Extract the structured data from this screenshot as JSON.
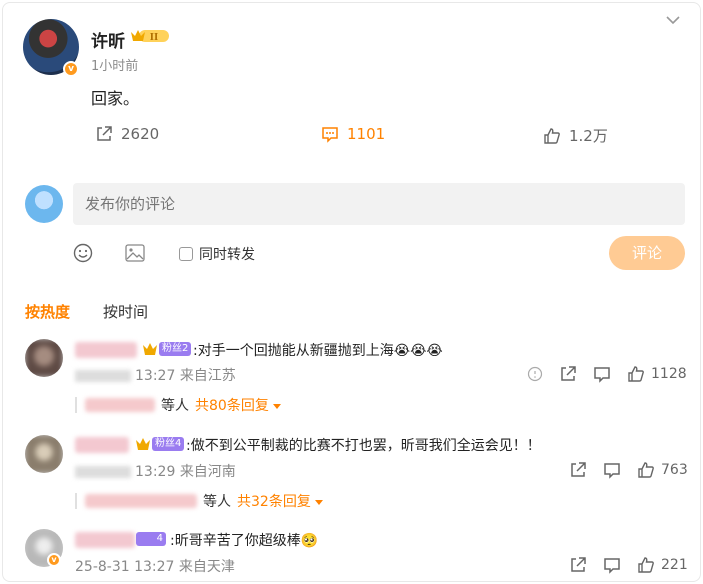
{
  "post": {
    "author": "许昕",
    "badge_level": "II",
    "time": "1小时前",
    "text": "回家。",
    "reposts": "2620",
    "comments": "1101",
    "likes": "1.2万"
  },
  "compose": {
    "placeholder": "发布你的评论",
    "repost_label": "同时转发",
    "submit_label": "评论"
  },
  "sort": {
    "hot": "按热度",
    "time": "按时间"
  },
  "comments": [
    {
      "level": "粉丝2",
      "text": ":对手一个回抛能从新疆抛到上海😭😭😭",
      "time": "13:27",
      "location": "来自江苏",
      "likes": "1128",
      "reply_suffix": "等人",
      "reply_link": "共80条回复"
    },
    {
      "level": "粉丝4",
      "text": ":做不到公平制裁的比赛不打也罢，昕哥我们全运会见！！",
      "time": "13:29",
      "location": "来自河南",
      "likes": "763",
      "reply_suffix": "等人",
      "reply_link": "共32条回复"
    },
    {
      "level": "4",
      "text": ":昕哥辛苦了你超级棒🥺",
      "date": "25-8-31",
      "time": "13:27",
      "location": "来自天津",
      "likes": "221"
    }
  ],
  "colors": {
    "accent": "#ff8200",
    "submit_disabled": "#ffcb94",
    "level_badge": "#9a7cf0"
  }
}
